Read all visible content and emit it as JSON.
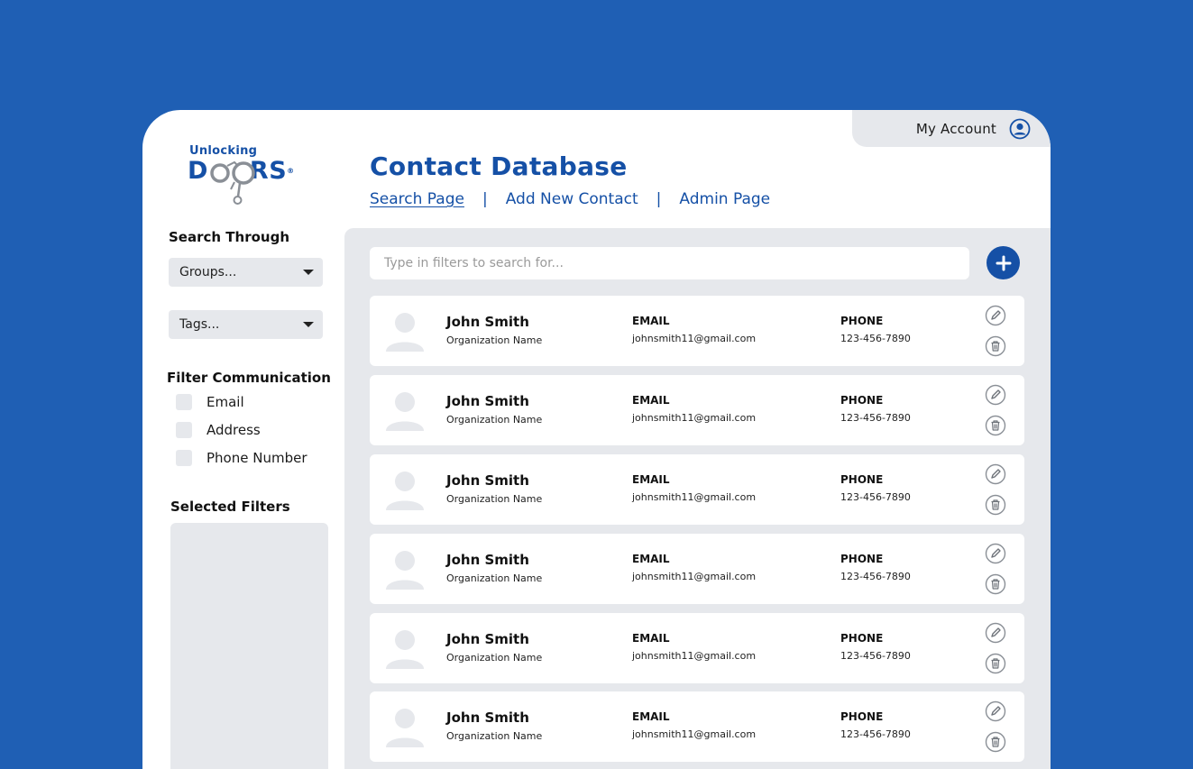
{
  "account": {
    "label": "My Account",
    "icon": "user-circle-icon"
  },
  "logo": {
    "top_text": "Unlocking",
    "main_left": "D",
    "main_right": "RS",
    "reg": "®"
  },
  "header": {
    "title": "Contact Database"
  },
  "nav": {
    "items": [
      {
        "label": "Search Page",
        "active": true
      },
      {
        "label": "Add New Contact",
        "active": false
      },
      {
        "label": "Admin Page",
        "active": false
      }
    ],
    "separator": "|"
  },
  "sidebar": {
    "search_title": "Search Through",
    "groups_label": "Groups...",
    "tags_label": "Tags...",
    "filter_title": "Filter Communication",
    "checkboxes": [
      "Email",
      "Address",
      "Phone Number"
    ],
    "selected_title": "Selected Filters"
  },
  "search": {
    "placeholder": "Type in filters to search for..."
  },
  "colors": {
    "background": "#1f5fb4",
    "brand": "#1550a6",
    "panel": "#e6e8ec"
  },
  "contacts": [
    {
      "name": "John Smith",
      "org": "Organization Name",
      "email_label": "EMAIL",
      "email": "johnsmith11@gmail.com",
      "phone_label": "PHONE",
      "phone": "123-456-7890"
    },
    {
      "name": "John Smith",
      "org": "Organization Name",
      "email_label": "EMAIL",
      "email": "johnsmith11@gmail.com",
      "phone_label": "PHONE",
      "phone": "123-456-7890"
    },
    {
      "name": "John Smith",
      "org": "Organization Name",
      "email_label": "EMAIL",
      "email": "johnsmith11@gmail.com",
      "phone_label": "PHONE",
      "phone": "123-456-7890"
    },
    {
      "name": "John Smith",
      "org": "Organization Name",
      "email_label": "EMAIL",
      "email": "johnsmith11@gmail.com",
      "phone_label": "PHONE",
      "phone": "123-456-7890"
    },
    {
      "name": "John Smith",
      "org": "Organization Name",
      "email_label": "EMAIL",
      "email": "johnsmith11@gmail.com",
      "phone_label": "PHONE",
      "phone": "123-456-7890"
    },
    {
      "name": "John Smith",
      "org": "Organization Name",
      "email_label": "EMAIL",
      "email": "johnsmith11@gmail.com",
      "phone_label": "PHONE",
      "phone": "123-456-7890"
    }
  ]
}
